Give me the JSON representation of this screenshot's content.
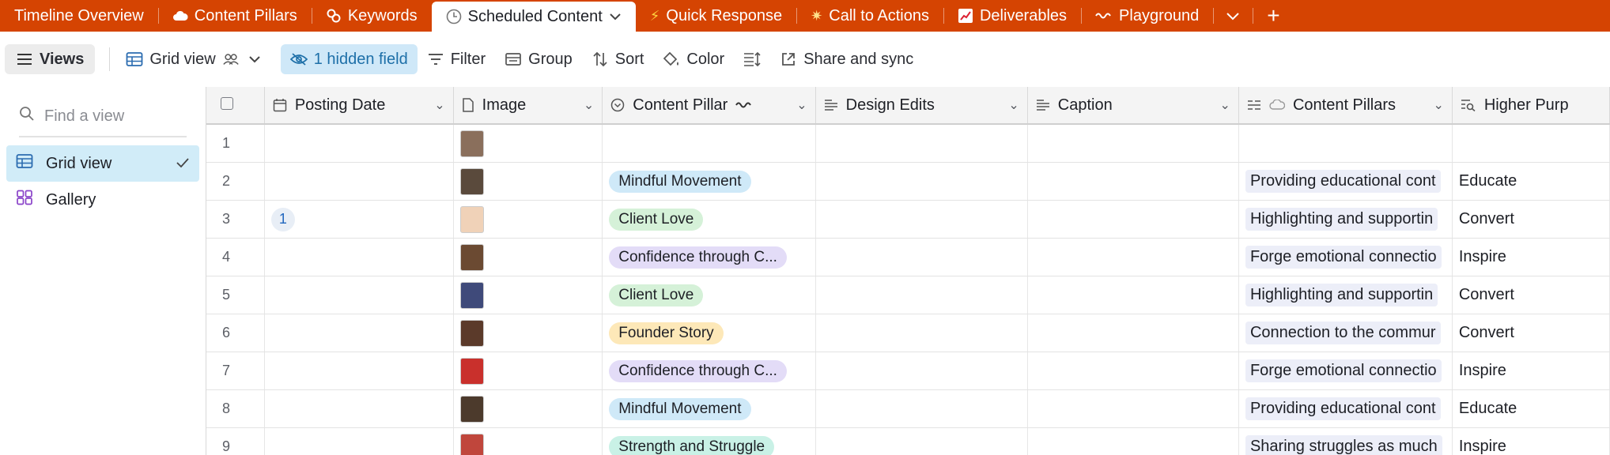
{
  "tabs": [
    {
      "label": "Timeline Overview",
      "icon": ""
    },
    {
      "label": "Content Pillars",
      "icon": "cloud-icon"
    },
    {
      "label": "Keywords",
      "icon": "link-icon"
    },
    {
      "label": "Scheduled Content",
      "icon": "clock-icon",
      "active": true
    },
    {
      "label": "Quick Response",
      "icon": "lightning-icon"
    },
    {
      "label": "Call to Actions",
      "icon": "sparkle-icon"
    },
    {
      "label": "Deliverables",
      "icon": "chart-icon"
    },
    {
      "label": "Playground",
      "icon": "wave-icon"
    }
  ],
  "toolbar": {
    "views_label": "Views",
    "view_name": "Grid view",
    "hidden_field": "1 hidden field",
    "filter": "Filter",
    "group": "Group",
    "sort": "Sort",
    "color": "Color",
    "share": "Share and sync"
  },
  "sidebar": {
    "find_placeholder": "Find a view",
    "views": [
      {
        "label": "Grid view",
        "selected": true
      },
      {
        "label": "Gallery",
        "selected": false
      }
    ]
  },
  "table": {
    "columns": [
      "Posting Date",
      "Image",
      "Content Pillar",
      "Design Edits",
      "Caption",
      "Content Pillars",
      "Higher Purp"
    ],
    "rows": [
      {
        "num": "1",
        "badge": "",
        "pillar": "",
        "pillar_color": "",
        "linked": "",
        "purpose": "",
        "thumb": "#8a6f5c"
      },
      {
        "num": "2",
        "badge": "",
        "pillar": "Mindful Movement",
        "pillar_color": "#cfe9f8",
        "linked": "Providing educational cont",
        "purpose": "Educate",
        "thumb": "#5a4a3c"
      },
      {
        "num": "3",
        "badge": "1",
        "pillar": "Client Love",
        "pillar_color": "#d5f1d8",
        "linked": "Highlighting and supportin",
        "purpose": "Convert",
        "thumb": "#f0d2b8"
      },
      {
        "num": "4",
        "badge": "",
        "pillar": "Confidence through C...",
        "pillar_color": "#e3dcf7",
        "linked": "Forge emotional connectio",
        "purpose": "Inspire",
        "thumb": "#6b4a32"
      },
      {
        "num": "5",
        "badge": "",
        "pillar": "Client Love",
        "pillar_color": "#d5f1d8",
        "linked": "Highlighting and supportin",
        "purpose": "Convert",
        "thumb": "#3f4a7a"
      },
      {
        "num": "6",
        "badge": "",
        "pillar": "Founder Story",
        "pillar_color": "#fde8b8",
        "linked": "Connection to the commur",
        "purpose": "Convert",
        "thumb": "#5b3a2a"
      },
      {
        "num": "7",
        "badge": "",
        "pillar": "Confidence through C...",
        "pillar_color": "#e3dcf7",
        "linked": "Forge emotional connectio",
        "purpose": "Inspire",
        "thumb": "#c9302c"
      },
      {
        "num": "8",
        "badge": "",
        "pillar": "Mindful Movement",
        "pillar_color": "#cfe9f8",
        "linked": "Providing educational cont",
        "purpose": "Educate",
        "thumb": "#4c3a2c"
      },
      {
        "num": "9",
        "badge": "",
        "pillar": "Strength and Struggle",
        "pillar_color": "#c9f1e6",
        "linked": "Sharing struggles as much",
        "purpose": "Inspire",
        "thumb": "#c0463c"
      }
    ]
  }
}
